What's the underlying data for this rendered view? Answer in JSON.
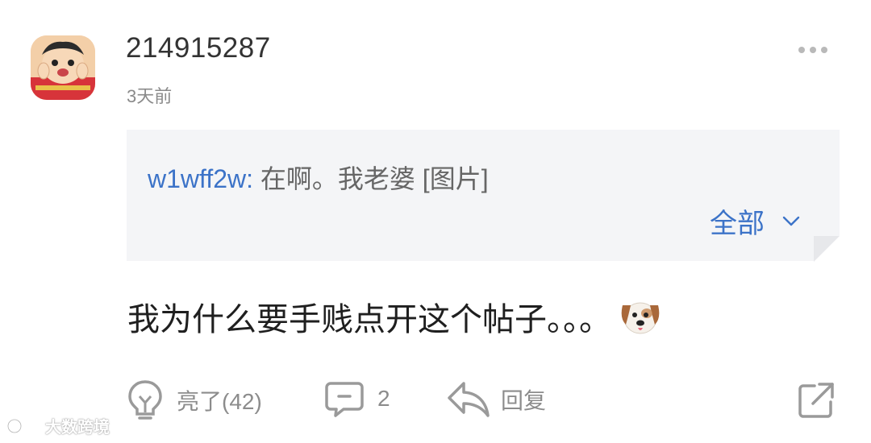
{
  "post": {
    "username": "214915287",
    "time_ago": "3天前",
    "more_icon": "more-dots-icon"
  },
  "quote": {
    "user": "w1wff2w:",
    "text": " 在啊。我老婆 [图片]",
    "expand_label": "全部",
    "expand_icon": "chevron-down-icon"
  },
  "comment": {
    "text": "我为什么要手贱点开这个帖子。。。",
    "emoji_icon": "dog-face-icon"
  },
  "actions": {
    "like_label": "亮了(42)",
    "reply_count": "2",
    "reply_label": "回复",
    "share_icon": "share-icon"
  },
  "watermark": {
    "text": "大数跨境"
  },
  "colors": {
    "link_blue": "#3c73c8",
    "quote_bg": "#f4f5f7",
    "muted": "#8c8c8c"
  }
}
